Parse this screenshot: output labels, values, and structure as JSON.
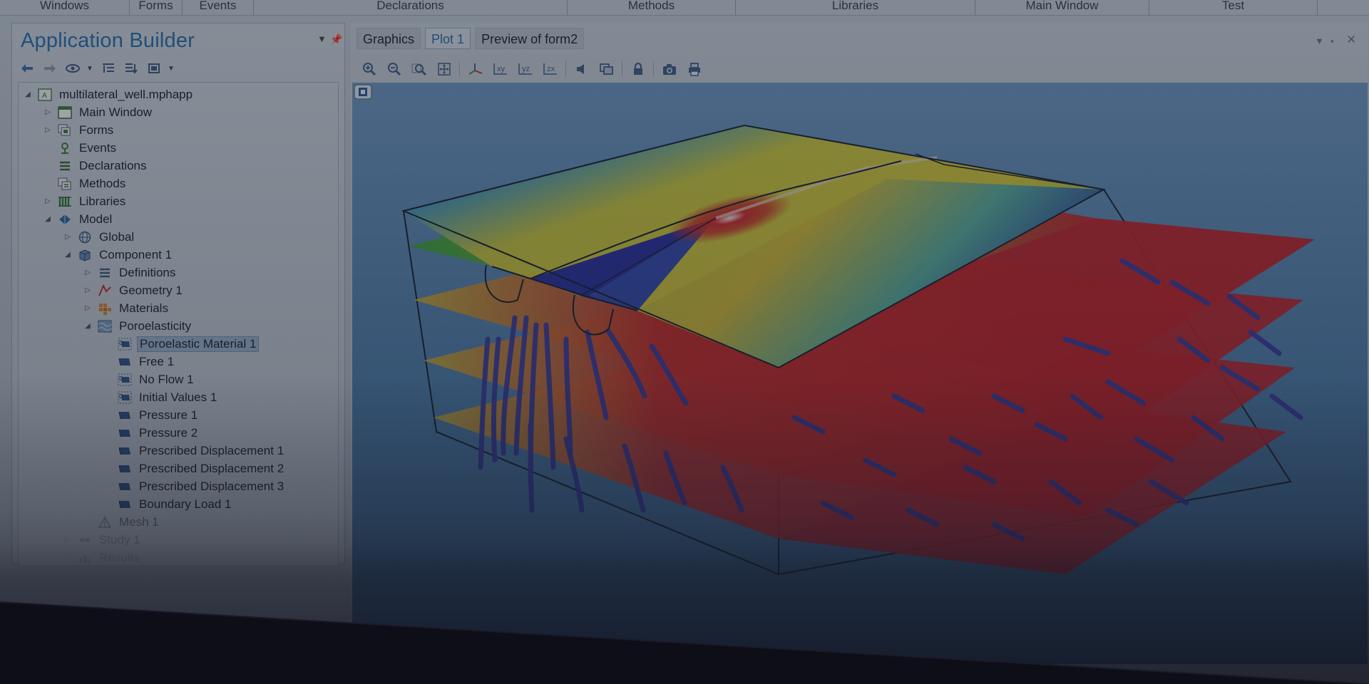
{
  "ribbon": {
    "groups": [
      "Windows",
      "Forms",
      "Events",
      "Declarations",
      "Methods",
      "Libraries",
      "Main Window",
      "Test"
    ]
  },
  "builder": {
    "title": "Application Builder",
    "toolbar_icons": [
      "arrow-left-icon",
      "arrow-right-icon",
      "eye-icon",
      "collapse-icon",
      "expand-icon",
      "layout-icon"
    ],
    "tree": [
      {
        "label": "multilateral_well.mphapp",
        "depth": 0,
        "expander": "open",
        "icon": "app-icon"
      },
      {
        "label": "Main Window",
        "depth": 1,
        "expander": "closed",
        "icon": "window-icon"
      },
      {
        "label": "Forms",
        "depth": 1,
        "expander": "closed",
        "icon": "forms-icon"
      },
      {
        "label": "Events",
        "depth": 1,
        "expander": "none",
        "icon": "events-icon"
      },
      {
        "label": "Declarations",
        "depth": 1,
        "expander": "none",
        "icon": "declarations-icon"
      },
      {
        "label": "Methods",
        "depth": 1,
        "expander": "none",
        "icon": "methods-icon"
      },
      {
        "label": "Libraries",
        "depth": 1,
        "expander": "closed",
        "icon": "libraries-icon"
      },
      {
        "label": "Model",
        "depth": 1,
        "expander": "open",
        "icon": "model-icon"
      },
      {
        "label": "Global",
        "depth": 2,
        "expander": "closed",
        "icon": "globe-icon"
      },
      {
        "label": "Component 1",
        "depth": 2,
        "expander": "open",
        "icon": "component-icon"
      },
      {
        "label": "Definitions",
        "depth": 3,
        "expander": "closed",
        "icon": "definitions-icon"
      },
      {
        "label": "Geometry 1",
        "depth": 3,
        "expander": "closed",
        "icon": "geometry-icon"
      },
      {
        "label": "Materials",
        "depth": 3,
        "expander": "closed",
        "icon": "materials-icon"
      },
      {
        "label": "Poroelasticity",
        "depth": 3,
        "expander": "open",
        "icon": "physics-icon"
      },
      {
        "label": "Poroelastic Material 1",
        "depth": 4,
        "expander": "none",
        "icon": "feature-d-icon",
        "selected": true
      },
      {
        "label": "Free 1",
        "depth": 4,
        "expander": "none",
        "icon": "feature-icon"
      },
      {
        "label": "No Flow 1",
        "depth": 4,
        "expander": "none",
        "icon": "feature-d-icon"
      },
      {
        "label": "Initial Values 1",
        "depth": 4,
        "expander": "none",
        "icon": "feature-d-icon"
      },
      {
        "label": "Pressure 1",
        "depth": 4,
        "expander": "none",
        "icon": "feature-icon"
      },
      {
        "label": "Pressure 2",
        "depth": 4,
        "expander": "none",
        "icon": "feature-icon"
      },
      {
        "label": "Prescribed Displacement 1",
        "depth": 4,
        "expander": "none",
        "icon": "feature-icon"
      },
      {
        "label": "Prescribed Displacement 2",
        "depth": 4,
        "expander": "none",
        "icon": "feature-icon"
      },
      {
        "label": "Prescribed Displacement 3",
        "depth": 4,
        "expander": "none",
        "icon": "feature-icon"
      },
      {
        "label": "Boundary Load 1",
        "depth": 4,
        "expander": "none",
        "icon": "feature-icon"
      },
      {
        "label": "Mesh 1",
        "depth": 3,
        "expander": "none",
        "icon": "mesh-icon"
      },
      {
        "label": "Study 1",
        "depth": 2,
        "expander": "closed",
        "icon": "study-icon"
      },
      {
        "label": "Results",
        "depth": 2,
        "expander": "closed",
        "icon": "results-icon"
      }
    ]
  },
  "graphics": {
    "tabs": [
      {
        "label": "Graphics",
        "active": false
      },
      {
        "label": "Plot 1",
        "active": true
      },
      {
        "label": "Preview of form2",
        "active": false
      }
    ],
    "toolbar_groups": [
      [
        "zoom-in-icon",
        "zoom-out-icon",
        "zoom-box-icon",
        "zoom-extents-icon"
      ],
      [
        "default-view-icon",
        "xy-view-icon",
        "yz-view-icon",
        "zx-view-icon"
      ],
      [
        "scene-light-icon",
        "transparency-icon"
      ],
      [
        "lock-icon"
      ],
      [
        "camera-icon",
        "print-icon"
      ]
    ],
    "xy_label": "xy",
    "yz_label": "yz",
    "zx_label": "zx"
  },
  "colors": {
    "accent": "#2b6da6",
    "selection": "#9db7d1",
    "viewport_top": "#6d96bd",
    "viewport_bottom": "#436f99",
    "slice_red": "#c0262b",
    "streamline": "#3b3fa0"
  }
}
